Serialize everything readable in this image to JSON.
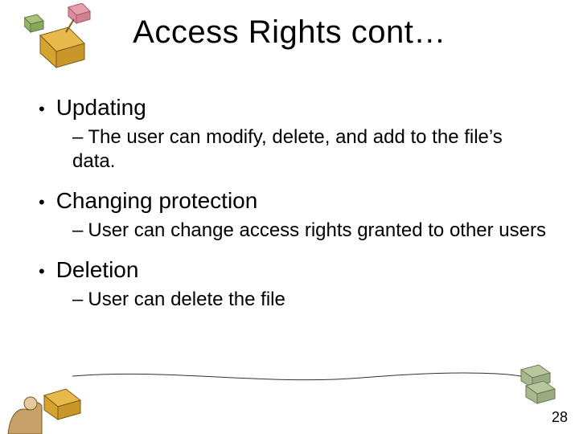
{
  "title": "Access Rights cont…",
  "bullets": [
    {
      "label": "Updating",
      "sub": "The user can modify, delete, and add to the file’s data."
    },
    {
      "label": "Changing protection",
      "sub": "User can change access rights granted to other users"
    },
    {
      "label": "Deletion",
      "sub": "User can delete the file"
    }
  ],
  "page_number": "28"
}
